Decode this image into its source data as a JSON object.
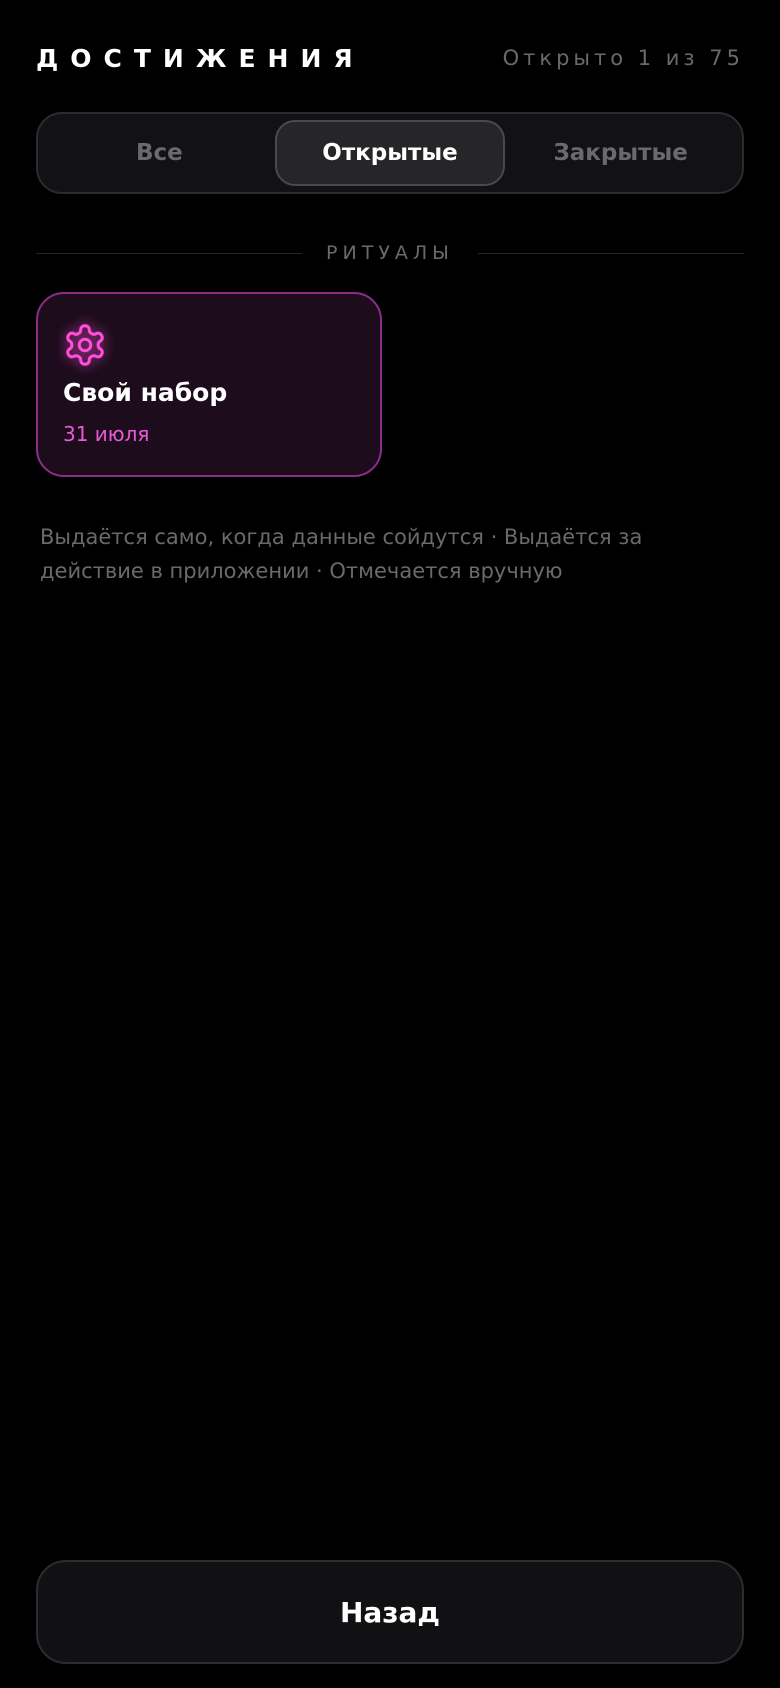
{
  "header": {
    "title": "ДОСТИЖЕНИЯ",
    "counter": "Открыто 1 из 75"
  },
  "tabs": [
    {
      "label": "Все",
      "active": false
    },
    {
      "label": "Открытые",
      "active": true
    },
    {
      "label": "Закрытые",
      "active": false
    }
  ],
  "section": {
    "label": "РИТУАЛЫ"
  },
  "card": {
    "icon": "gear-icon",
    "title": "Свой набор",
    "date": "31 июля"
  },
  "footnote": "Выдаётся само, когда данные сойдутся · Выдаётся за действие в приложении · Отмечается вручную",
  "back_button": {
    "label": "Назад"
  },
  "colors": {
    "background": "#000000",
    "accent": "#ff4fd8",
    "card_border": "#8a2e8a",
    "muted_text": "#6a6a6e"
  }
}
